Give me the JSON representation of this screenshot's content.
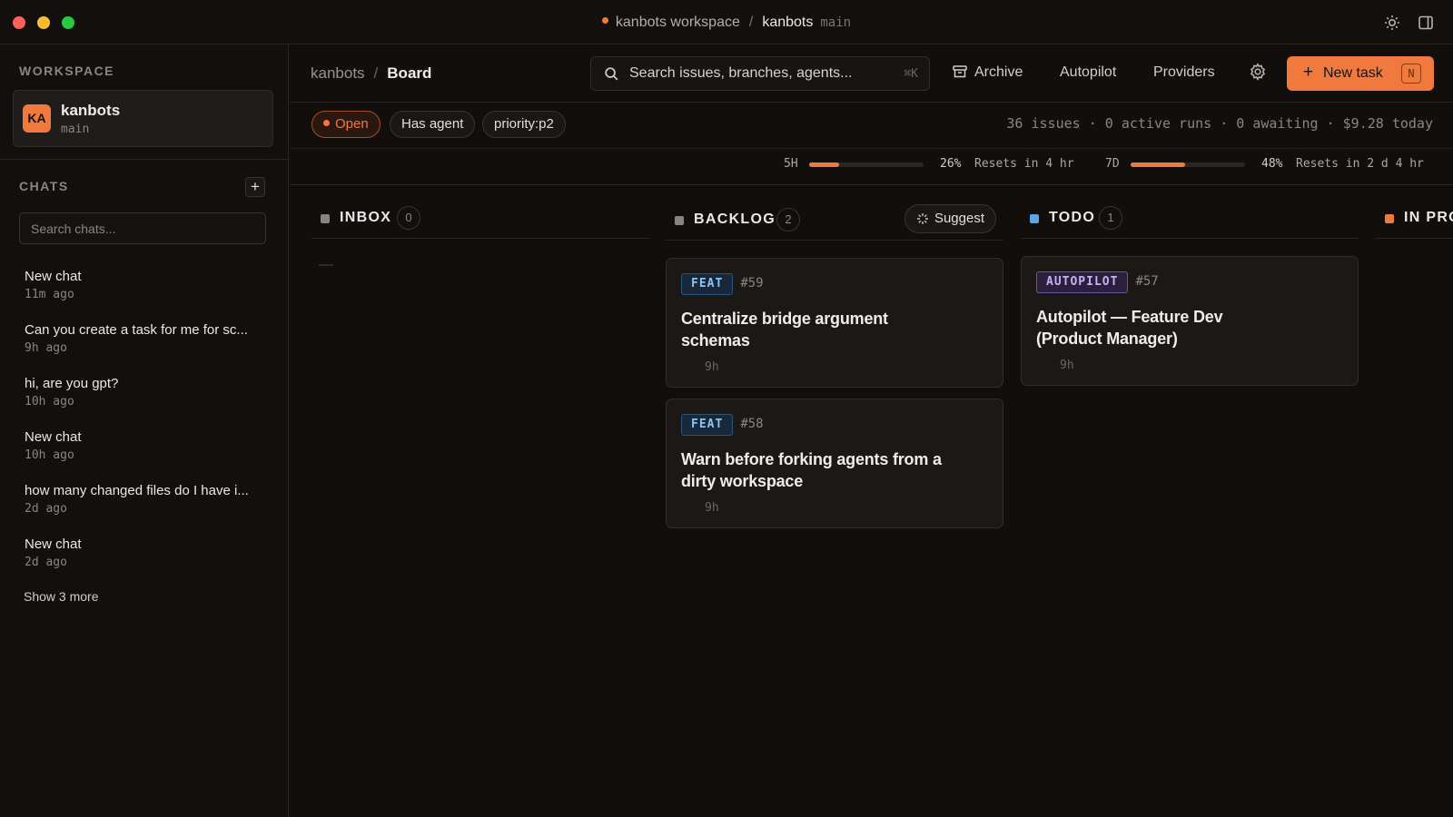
{
  "window": {
    "workspace": "kanbots workspace",
    "project": "kanbots",
    "branch": "main"
  },
  "sidebar": {
    "workspace_label": "WORKSPACE",
    "workspace": {
      "initials": "KA",
      "name": "kanbots",
      "branch": "main"
    },
    "chats_label": "CHATS",
    "add_chat": "+",
    "search_placeholder": "Search chats...",
    "chats": [
      {
        "title": "New chat",
        "time": "11m ago"
      },
      {
        "title": "Can you create a task for me for sc...",
        "time": "9h ago"
      },
      {
        "title": "hi, are you gpt?",
        "time": "10h ago"
      },
      {
        "title": "New chat",
        "time": "10h ago"
      },
      {
        "title": "how many changed files do I have i...",
        "time": "2d ago"
      },
      {
        "title": "New chat",
        "time": "2d ago"
      }
    ],
    "show_more": "Show 3 more"
  },
  "header": {
    "breadcrumb": [
      "kanbots",
      "Board"
    ],
    "search_placeholder": "Search issues, branches, agents...",
    "search_shortcut": "⌘K",
    "archive": "Archive",
    "autopilot": "Autopilot",
    "providers": "Providers",
    "new_task": "New task",
    "new_task_shortcut": "N"
  },
  "filters": {
    "open": "Open",
    "has_agent": "Has agent",
    "priority": "priority:p2",
    "stats": "36 issues · 0 active runs · 0 awaiting · $9.28 today"
  },
  "usage": [
    {
      "label": "5H",
      "percent": 26,
      "percent_text": "26%",
      "resets": "Resets in 4 hr"
    },
    {
      "label": "7D",
      "percent": 48,
      "percent_text": "48%",
      "resets": "Resets in 2 d 4 hr"
    }
  ],
  "columns": [
    {
      "title": "INBOX",
      "count": "0",
      "color": "#8a8480",
      "empty": "—"
    },
    {
      "title": "BACKLOG",
      "count": "2",
      "color": "#8a8480",
      "action": "Suggest",
      "cards": [
        {
          "badge": "FEAT",
          "number": "#59",
          "title": "Centralize bridge argument schemas",
          "time": "9h"
        },
        {
          "badge": "FEAT",
          "number": "#58",
          "title": "Warn before forking agents from a dirty workspace",
          "time": "9h"
        }
      ]
    },
    {
      "title": "TODO",
      "count": "1",
      "color": "#5aa6e8",
      "cards": [
        {
          "badge": "AUTOPILOT",
          "number": "#57",
          "title": "Autopilot — Feature Dev (Product Manager)",
          "time": "9h"
        }
      ]
    },
    {
      "title": "IN PRO",
      "color": "#f0793e",
      "empty": "—"
    }
  ],
  "colors": {
    "accent": "#f0793e",
    "background": "#110e0c"
  }
}
